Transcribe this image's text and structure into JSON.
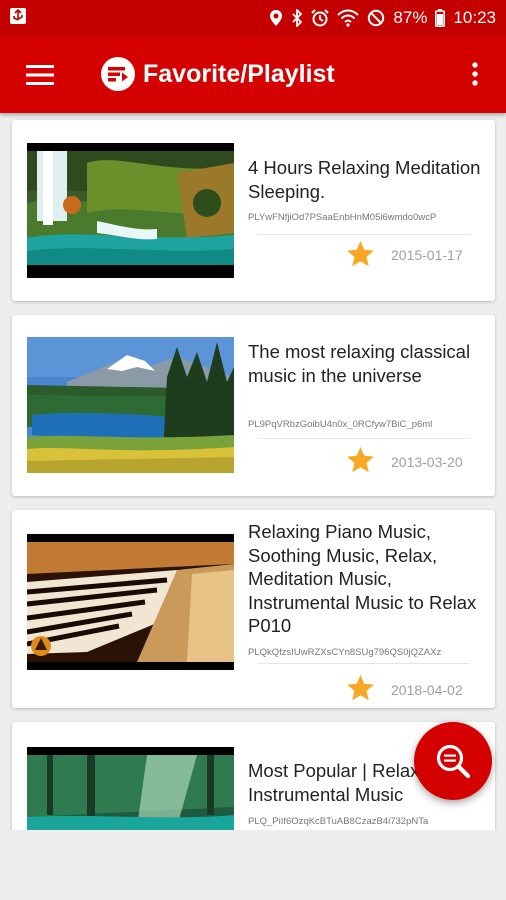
{
  "status_bar": {
    "battery_percent": "87%",
    "time": "10:23"
  },
  "app_bar": {
    "title": "Favorite/Playlist"
  },
  "playlists": [
    {
      "title": "4 Hours Relaxing Meditation Sleeping.",
      "id": "PLYwFNfjiOd7PSaaEnbHnM05i6wmdo0wcP",
      "date": "2015-01-17",
      "thumbnail": "waterfall-landscape"
    },
    {
      "title": "The most relaxing classical music in the universe",
      "id": "PL9PqVRbzGoibU4n0x_0RCfyw7BiC_p6ml",
      "date": "2013-03-20",
      "thumbnail": "mountain-lake-landscape"
    },
    {
      "title": "Relaxing Piano Music, Soothing Music, Relax, Meditation Music, Instrumental Music to Relax P010",
      "id": "PLQkQfzsIUwRZXsCYn8SUg796QS0jQZAXz",
      "date": "2018-04-02",
      "thumbnail": "piano-keys"
    },
    {
      "title": "Most Popular | Relaxing Instrumental Music",
      "id": "PLQ_PiIf6OzqKcBTuAB8CzazB4i732pNTa",
      "date": "",
      "thumbnail": "forest-lagoon"
    }
  ],
  "colors": {
    "primary": "#d50000",
    "status_bar": "#c40000",
    "star": "#f9a825"
  }
}
